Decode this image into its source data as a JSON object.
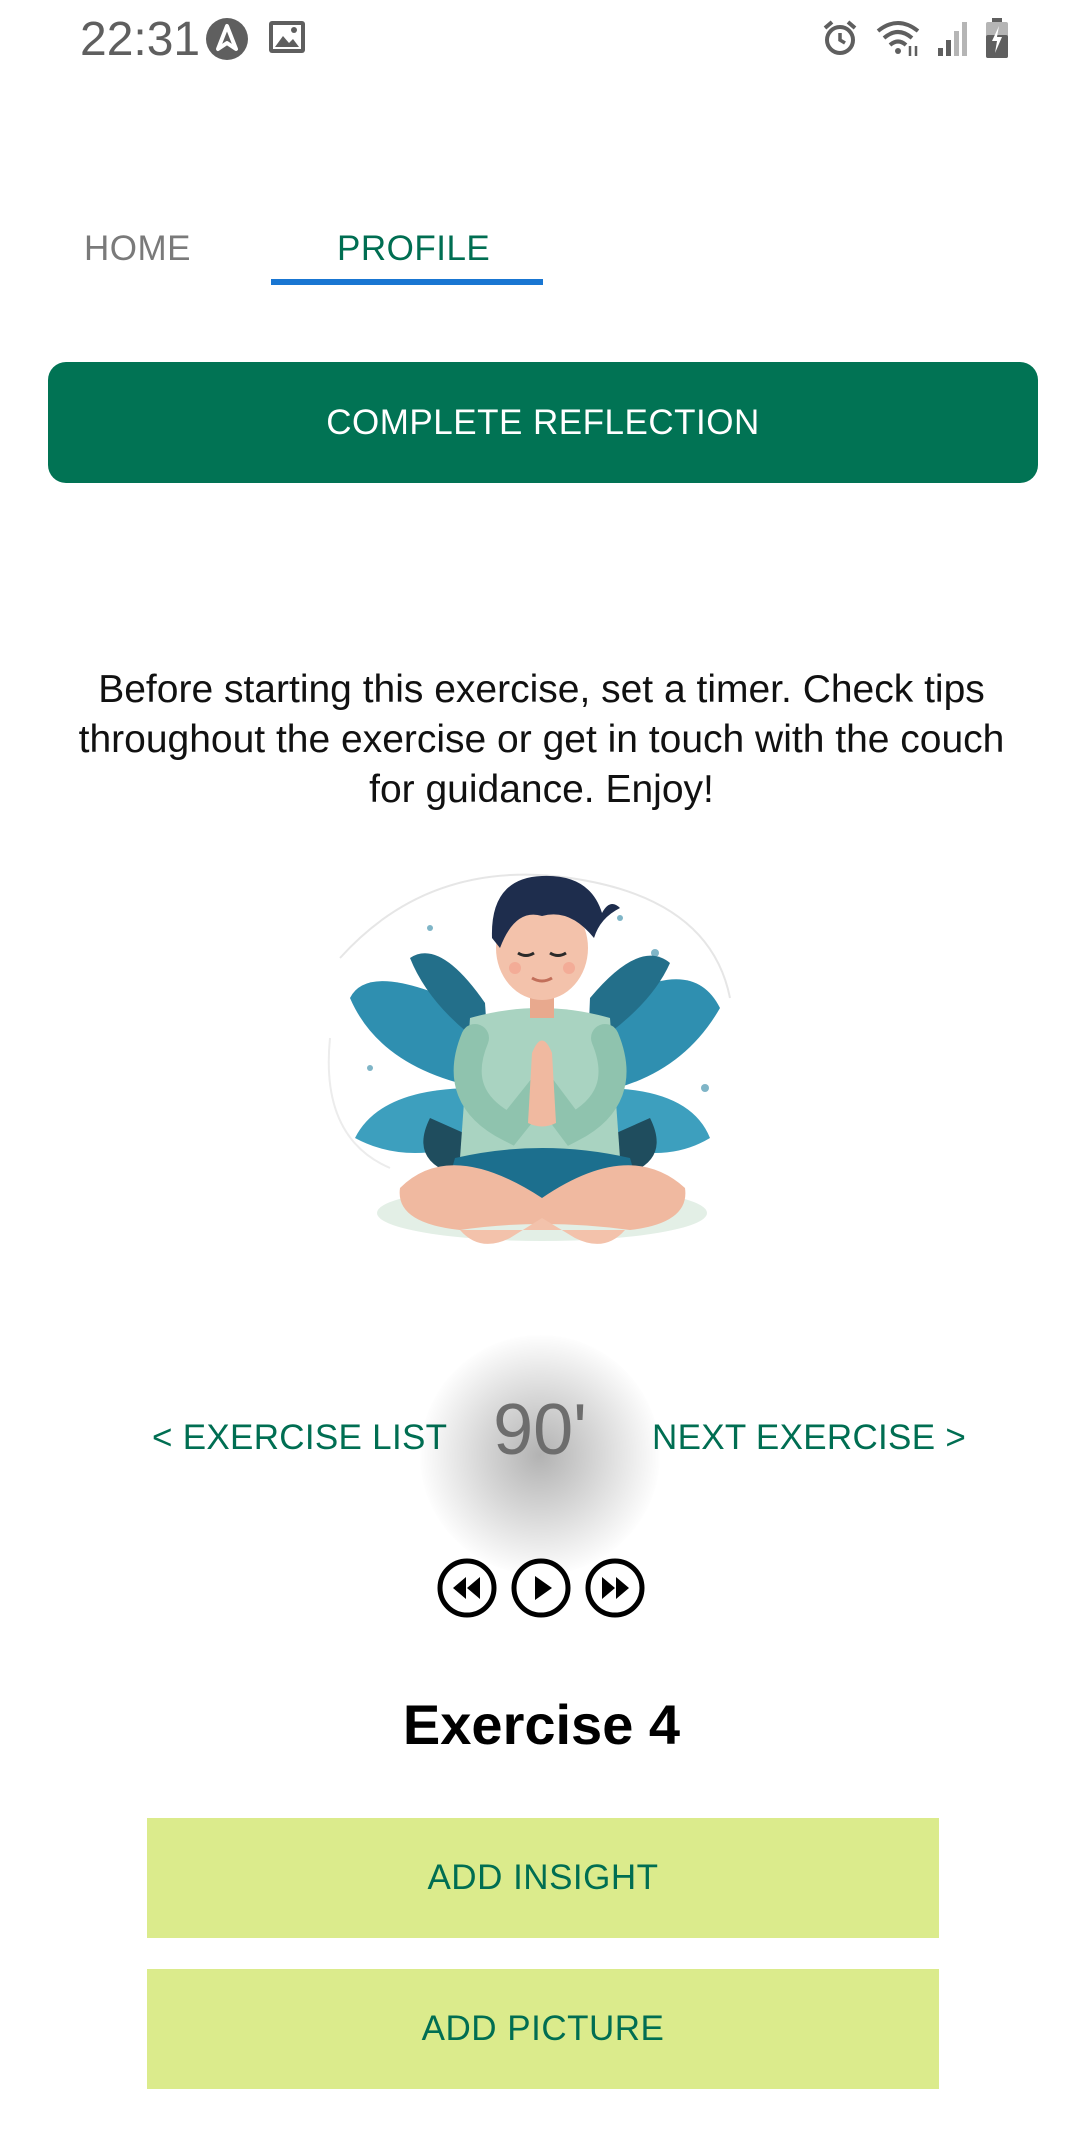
{
  "status_bar": {
    "time": "22:31",
    "left_icons": [
      "navigation-icon",
      "image-icon"
    ],
    "right_icons": [
      "alarm-icon",
      "wifi-icon",
      "signal-icon",
      "battery-icon"
    ]
  },
  "tabs": [
    {
      "label": "HOME",
      "active": false
    },
    {
      "label": "PROFILE",
      "active": true
    }
  ],
  "primary_action": {
    "label": "COMPLETE REFLECTION"
  },
  "intro_text": "Before starting this exercise, set a timer. Check tips throughout the exercise or get in touch with the couch for guidance. Enjoy!",
  "illustration": {
    "icon": "meditation-illustration"
  },
  "navigation": {
    "prev_label": "< EXERCISE LIST",
    "next_label": "NEXT EXERCISE >",
    "timer": "90'"
  },
  "media_controls": [
    "rewind-icon",
    "play-icon",
    "fast-forward-icon"
  ],
  "exercise": {
    "title": "Exercise 4"
  },
  "actions": {
    "add_insight": "ADD INSIGHT",
    "add_picture": "ADD PICTURE"
  },
  "colors": {
    "primary": "#017354",
    "accent_text": "#006e52",
    "tab_indicator": "#1976d2",
    "secondary_button": "#dbeb8c"
  }
}
